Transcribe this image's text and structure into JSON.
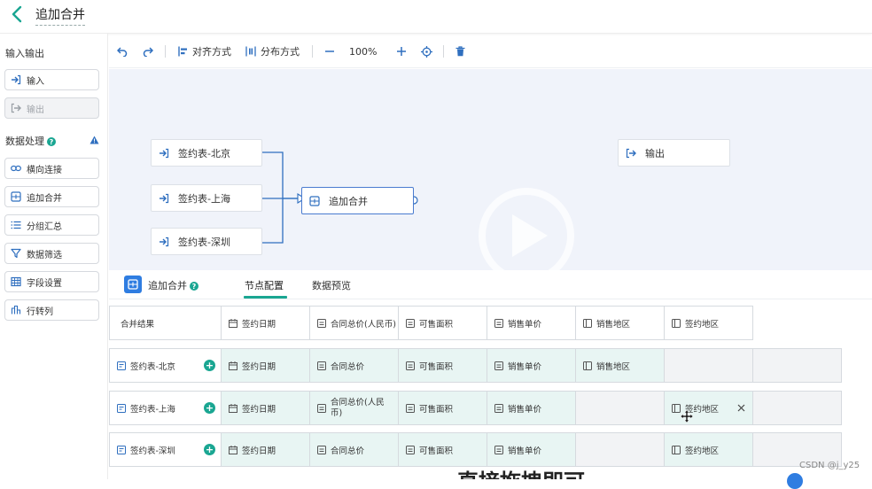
{
  "header": {
    "title": "追加合并"
  },
  "sidebar": {
    "io_title": "输入输出",
    "io_items": [
      {
        "label": "输入"
      },
      {
        "label": "输出"
      }
    ],
    "proc_title": "数据处理",
    "help": "?",
    "proc_items": [
      {
        "label": "横向连接"
      },
      {
        "label": "追加合并"
      },
      {
        "label": "分组汇总"
      },
      {
        "label": "数据筛选"
      },
      {
        "label": "字段设置"
      },
      {
        "label": "行转列"
      }
    ]
  },
  "toolbar": {
    "align": "对齐方式",
    "distribute": "分布方式",
    "zoom": "100%"
  },
  "canvas": {
    "nodes": [
      {
        "label": "签约表-北京"
      },
      {
        "label": "签约表-上海"
      },
      {
        "label": "签约表-深圳"
      }
    ],
    "merge_node": "追加合并",
    "output_node": "输出"
  },
  "panel": {
    "title": "追加合并",
    "tabs": [
      {
        "label": "节点配置"
      },
      {
        "label": "数据预览"
      }
    ],
    "header_cells": [
      "合并结果",
      "签约日期",
      "合同总价(人民币)",
      "可售面积",
      "销售单价",
      "销售地区",
      "签约地区"
    ],
    "rows": [
      {
        "name": "签约表-北京",
        "cells": [
          "签约日期",
          "合同总价",
          "可售面积",
          "销售单价",
          "销售地区",
          "",
          ""
        ]
      },
      {
        "name": "签约表-上海",
        "cells": [
          "签约日期",
          "合同总价(人民币)",
          "可售面积",
          "销售单价",
          "",
          "签约地区",
          ""
        ]
      },
      {
        "name": "签约表-深圳",
        "cells": [
          "签约日期",
          "合同总价",
          "可售面积",
          "销售单价",
          "",
          "签约地区",
          ""
        ]
      }
    ]
  },
  "watermark": "CSDN @j_y25",
  "bottom_text": "直接拖拽即可"
}
